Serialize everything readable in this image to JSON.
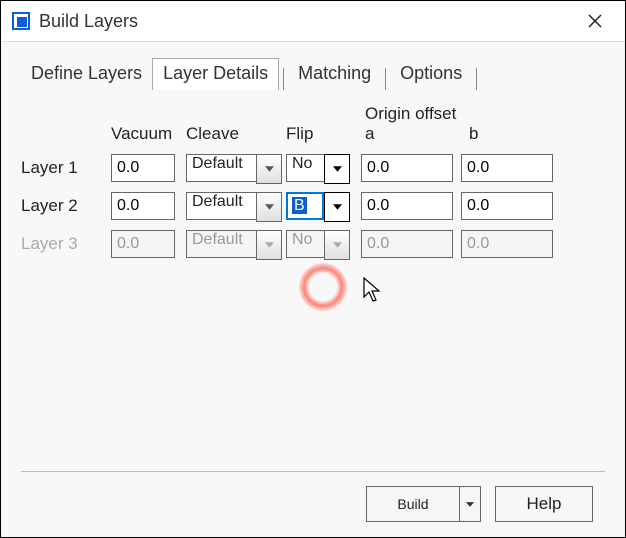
{
  "window": {
    "title": "Build Layers"
  },
  "tabs": {
    "define": "Define Layers",
    "details": "Layer Details",
    "matching": "Matching",
    "options": "Options"
  },
  "headers": {
    "vacuum": "Vacuum",
    "cleave": "Cleave",
    "flip": "Flip",
    "origin_offset": "Origin offset",
    "a": "a",
    "b": "b"
  },
  "rows": [
    {
      "label": "Layer 1",
      "vacuum": "0.0",
      "cleave": "Default",
      "flip": "No",
      "a": "0.0",
      "b": "0.0",
      "disabled": false
    },
    {
      "label": "Layer 2",
      "vacuum": "0.0",
      "cleave": "Default",
      "flip": "B",
      "a": "0.0",
      "b": "0.0",
      "disabled": false,
      "focus": true
    },
    {
      "label": "Layer 3",
      "vacuum": "0.0",
      "cleave": "Default",
      "flip": "No",
      "a": "0.0",
      "b": "0.0",
      "disabled": true
    }
  ],
  "buttons": {
    "build": "Build",
    "help": "Help"
  }
}
